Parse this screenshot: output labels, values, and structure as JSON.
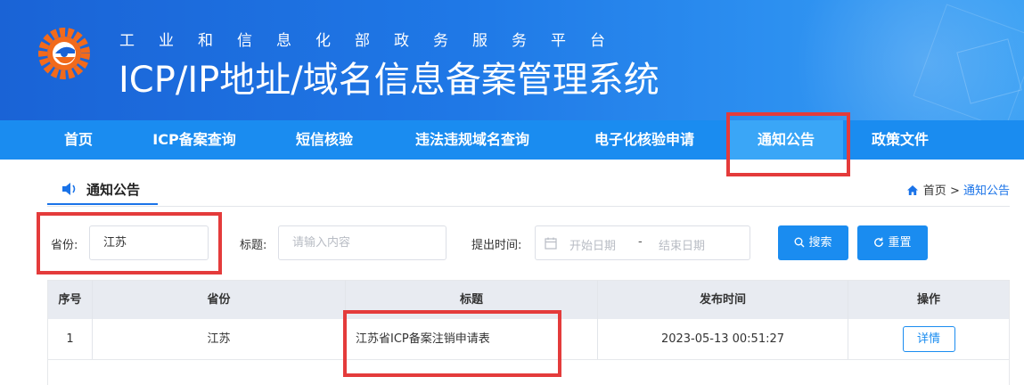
{
  "header": {
    "subtitle": "工业和信息化部政务服务平台",
    "title": "ICP/IP地址/域名信息备案管理系统"
  },
  "nav": {
    "items": [
      {
        "label": "首页"
      },
      {
        "label": "ICP备案查询"
      },
      {
        "label": "短信核验"
      },
      {
        "label": "违法违规域名查询"
      },
      {
        "label": "电子化核验申请"
      },
      {
        "label": "通知公告",
        "active": true
      },
      {
        "label": "政策文件"
      }
    ]
  },
  "section": {
    "tab_label": "通知公告",
    "breadcrumb": {
      "home": "首页",
      "separator": ">",
      "current": "通知公告"
    }
  },
  "filters": {
    "province_label": "省份:",
    "province_value": "江苏",
    "title_label": "标题:",
    "title_placeholder": "请输入内容",
    "time_label": "提出时间:",
    "start_placeholder": "开始日期",
    "range_separator": "-",
    "end_placeholder": "结束日期",
    "search_button": "搜索",
    "reset_button": "重置"
  },
  "table": {
    "columns": [
      "序号",
      "省份",
      "标题",
      "发布时间",
      "操作"
    ],
    "rows": [
      {
        "index": "1",
        "province": "江苏",
        "title": "江苏省ICP备案注销申请表",
        "time": "2023-05-13 00:51:27",
        "action": "详情"
      }
    ]
  },
  "colors": {
    "primary": "#1a8cf0",
    "nav_active": "#3aa6f7",
    "highlight": "#e43b3b"
  },
  "icons": [
    "logo-icon",
    "speaker-icon",
    "home-icon",
    "calendar-icon",
    "search-icon",
    "refresh-icon"
  ]
}
